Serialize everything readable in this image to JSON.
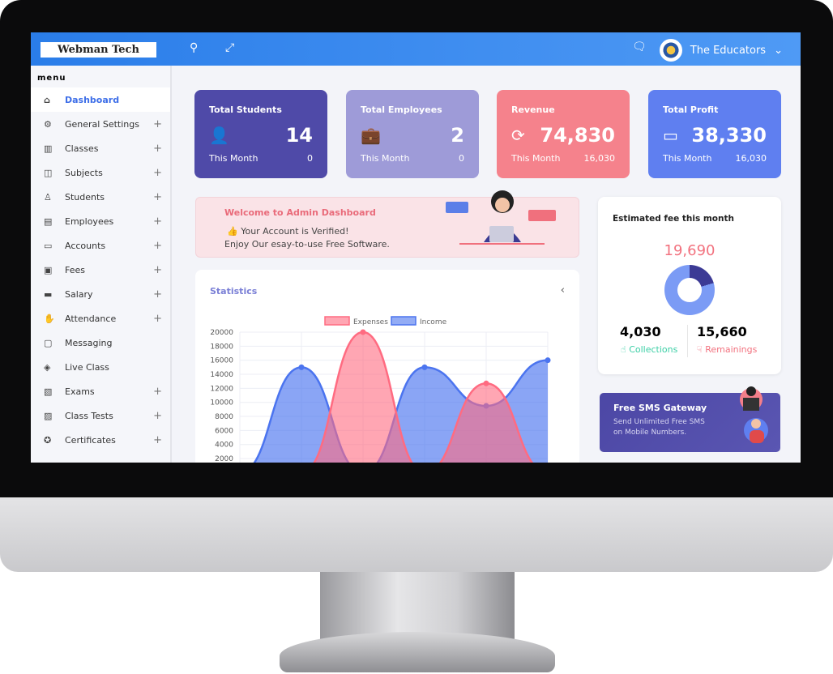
{
  "header": {
    "logo": "Webman Tech",
    "user_name": "The Educators"
  },
  "sidebar": {
    "title": "menu",
    "items": [
      {
        "label": "Dashboard",
        "icon": "⌂",
        "expand": false,
        "active": true
      },
      {
        "label": "General Settings",
        "icon": "⚙",
        "expand": true
      },
      {
        "label": "Classes",
        "icon": "▥",
        "expand": true
      },
      {
        "label": "Subjects",
        "icon": "◫",
        "expand": true
      },
      {
        "label": "Students",
        "icon": "♙",
        "expand": true
      },
      {
        "label": "Employees",
        "icon": "▤",
        "expand": true
      },
      {
        "label": "Accounts",
        "icon": "▭",
        "expand": true
      },
      {
        "label": "Fees",
        "icon": "▣",
        "expand": true
      },
      {
        "label": "Salary",
        "icon": "▬",
        "expand": true
      },
      {
        "label": "Attendance",
        "icon": "✋",
        "expand": true
      },
      {
        "label": "Messaging",
        "icon": "▢",
        "expand": false
      },
      {
        "label": "Live Class",
        "icon": "◈",
        "expand": false
      },
      {
        "label": "Exams",
        "icon": "▧",
        "expand": true
      },
      {
        "label": "Class Tests",
        "icon": "▨",
        "expand": true
      },
      {
        "label": "Certificates",
        "icon": "✪",
        "expand": true
      }
    ]
  },
  "cards": [
    {
      "title": "Total Students",
      "value": "14",
      "period": "This Month",
      "sub": "0",
      "icon": "👤",
      "color": "#4f4aa8"
    },
    {
      "title": "Total Employees",
      "value": "2",
      "period": "This Month",
      "sub": "0",
      "icon": "💼",
      "color": "#9e9bd8"
    },
    {
      "title": "Revenue",
      "value": "74,830",
      "period": "This Month",
      "sub": "16,030",
      "icon": "⟳",
      "color": "#f5828c"
    },
    {
      "title": "Total Profit",
      "value": "38,330",
      "period": "This Month",
      "sub": "16,030",
      "icon": "▭",
      "color": "#5f7ff0"
    }
  ],
  "welcome": {
    "title": "Welcome to Admin Dashboard",
    "line1": "Your Account is Verified!",
    "line2": "Enjoy Our esay-to-use Free Software."
  },
  "stats": {
    "title": "Statistics"
  },
  "fee": {
    "title": "Estimated fee this month",
    "total": "19,690",
    "collections": "4,030",
    "collections_label": "Collections",
    "remainings": "15,660",
    "remainings_label": "Remainings"
  },
  "sms": {
    "title": "Free SMS Gateway",
    "line1": "Send Unlimited Free SMS",
    "line2": "on Mobile Numbers."
  },
  "chart_data": {
    "type": "area",
    "title": "",
    "xlabel": "",
    "ylabel": "",
    "ylim": [
      0,
      20000
    ],
    "yticks": [
      2000,
      4000,
      6000,
      8000,
      10000,
      12000,
      14000,
      16000,
      18000,
      20000
    ],
    "legend": "top",
    "x": [
      0,
      1,
      2,
      3,
      4,
      5
    ],
    "series": [
      {
        "name": "Expenses",
        "color": "#ff6b81",
        "values": [
          0,
          0,
          20000,
          0,
          12700,
          0
        ]
      },
      {
        "name": "Income",
        "color": "#4b74ef",
        "values": [
          0,
          15000,
          0,
          15000,
          9500,
          16000
        ]
      }
    ]
  }
}
